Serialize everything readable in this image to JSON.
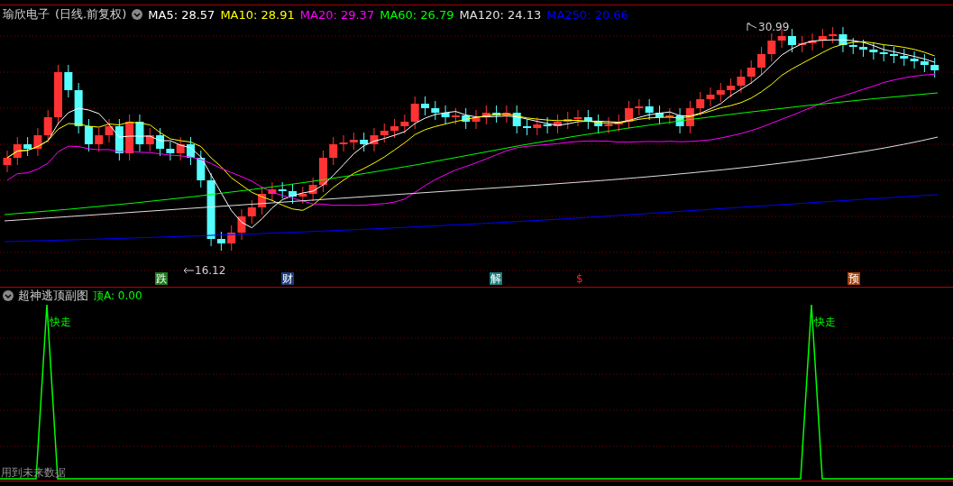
{
  "header": {
    "title": "瑜欣电子",
    "period": "(日线.前复权)",
    "indicators": [
      {
        "label": "MA5: 28.57",
        "color": "#ffffff"
      },
      {
        "label": "MA10: 28.91",
        "color": "#ffff00"
      },
      {
        "label": "MA20: 29.37",
        "color": "#ff00ff"
      },
      {
        "label": "MA60: 26.79",
        "color": "#00ff00"
      },
      {
        "label": "MA120: 24.13",
        "color": "#e0e0e0"
      },
      {
        "label": "MA250: 20.66",
        "color": "#0000ff"
      }
    ]
  },
  "price_labels": {
    "high": "30.99",
    "low": "16.12"
  },
  "events": [
    {
      "label": "跌",
      "kind": "badge",
      "color": "#1e7a1e"
    },
    {
      "label": "财",
      "kind": "badge",
      "color": "#1c3c7a"
    },
    {
      "label": "解",
      "kind": "badge",
      "color": "#1c7a7a"
    },
    {
      "label": "$",
      "kind": "text",
      "color": "#ff2020"
    },
    {
      "label": "预",
      "kind": "badge",
      "color": "#a0400a"
    }
  ],
  "sub_chart": {
    "title": "超神逃顶副图",
    "readout": "顶A: 0.00",
    "signals": [
      "快走",
      "快走"
    ],
    "warning": "用到未来数据"
  }
}
